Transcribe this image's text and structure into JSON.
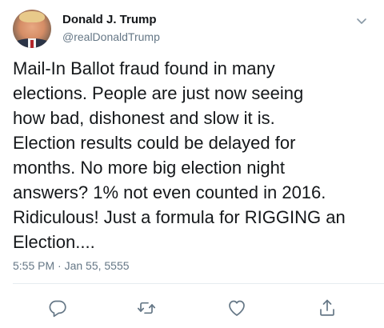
{
  "user": {
    "display_name": "Donald J. Trump",
    "handle": "@realDonaldTrump"
  },
  "tweet": {
    "text": "Mail-In Ballot fraud found in many\nelections. People are just now seeing\nhow bad, dishonest and slow it is.\nElection results could be delayed for\nmonths. No more big election night\nanswers? 1% not even counted in 2016.\nRidiculous! Just a formula for RIGGING an\nElection....",
    "timestamp": "5:55 PM · Jan 55, 5555"
  },
  "icons": {
    "menu": "chevron-down-icon",
    "reply": "reply-icon",
    "retweet": "retweet-icon",
    "like": "heart-icon",
    "share": "share-icon"
  },
  "colors": {
    "text": "#14171a",
    "secondary": "#657786",
    "icon": "#657786",
    "divider": "#e6ecf0"
  }
}
